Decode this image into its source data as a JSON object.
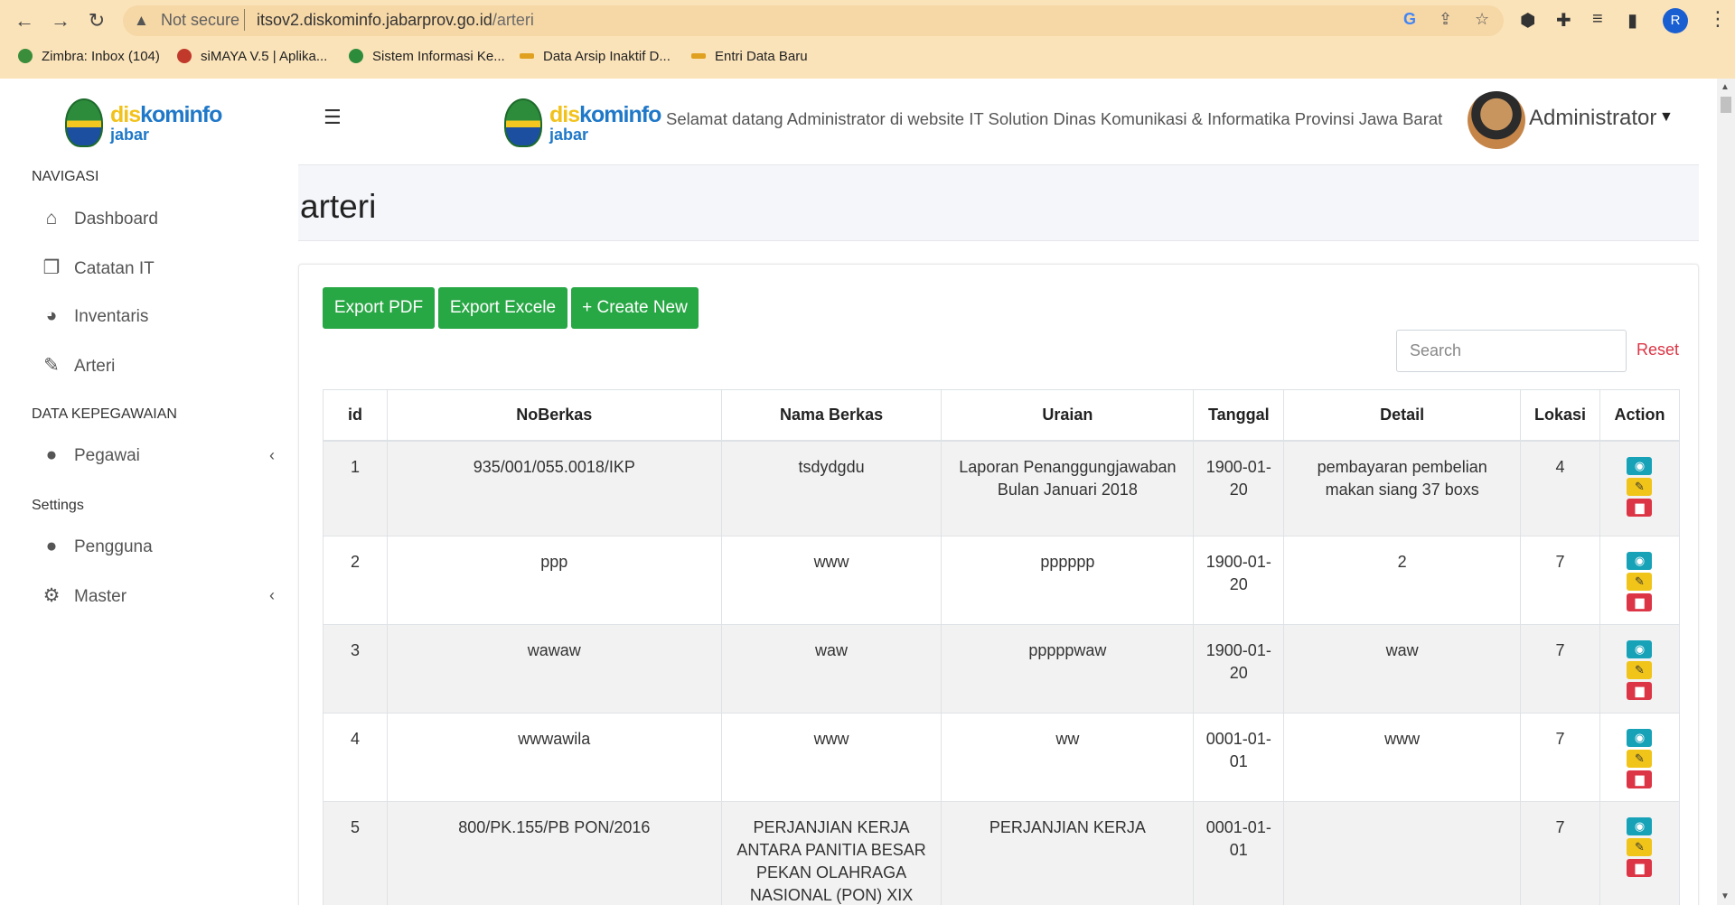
{
  "browser": {
    "security": "Not secure",
    "url_host": "itsov2.diskominfo.jabarprov.go.id",
    "url_path": "/arteri",
    "profile_initial": "R",
    "bookmarks": [
      {
        "label": "Zimbra: Inbox (104)",
        "color": "#3a8d3a"
      },
      {
        "label": "siMAYA V.5 | Aplika...",
        "color": "#c0392b"
      },
      {
        "label": "Sistem Informasi Ke...",
        "color": "#2d8c3c"
      },
      {
        "label": "Data Arsip Inaktif D...",
        "color": "#e0a020"
      },
      {
        "label": "Entri Data Baru",
        "color": "#e0a020"
      }
    ]
  },
  "brand": {
    "part1": "dis",
    "part2": "kominfo",
    "part3": "jabar"
  },
  "sidebar": {
    "sections": [
      "NAVIGASI",
      "DATA KEPEGAWAIAN",
      "Settings"
    ],
    "items": [
      {
        "label": "Dashboard",
        "icon": "home-icon",
        "glyph": "⌂"
      },
      {
        "label": "Catatan IT",
        "icon": "copy-icon",
        "glyph": "❐"
      },
      {
        "label": "Inventaris",
        "icon": "chart-pie-icon",
        "glyph": "◕"
      },
      {
        "label": "Arteri",
        "icon": "edit-icon",
        "glyph": "✎"
      },
      {
        "label": "Pegawai",
        "icon": "user-icon",
        "glyph": "👤"
      },
      {
        "label": "Pengguna",
        "icon": "user-plus-icon",
        "glyph": "👥"
      },
      {
        "label": "Master",
        "icon": "cog-icon",
        "glyph": "⚙"
      }
    ]
  },
  "header": {
    "welcome": "Selamat datang Administrator di website IT Solution Dinas Komunikasi & Informatika Provinsi Jawa Barat",
    "user": "Administrator"
  },
  "main": {
    "title": "arteri",
    "buttons": {
      "export_pdf": "Export PDF",
      "export_excel": "Export Excele",
      "create": "+ Create New"
    },
    "search_placeholder": "Search",
    "reset": "Reset",
    "columns": [
      "id",
      "NoBerkas",
      "Nama Berkas",
      "Uraian",
      "Tanggal",
      "Detail",
      "Lokasi",
      "Action"
    ],
    "rows": [
      [
        "1",
        "935/001/055.0018/IKP",
        "tsdydgdu",
        "Laporan Penanggungjawaban Bulan Januari 2018",
        "1900-01-20",
        "pembayaran pembelian makan siang 37 boxs",
        "4"
      ],
      [
        "2",
        "ppp",
        "www",
        "pppppp",
        "1900-01-20",
        "2",
        "7"
      ],
      [
        "3",
        "wawaw",
        "waw",
        "pppppwaw",
        "1900-01-20",
        "waw",
        "7"
      ],
      [
        "4",
        "wwwawila",
        "www",
        "ww",
        "0001-01-01",
        "www",
        "7"
      ],
      [
        "5",
        "800/PK.155/PB PON/2016",
        "PERJANJIAN KERJA ANTARA PANITIA BESAR PEKAN OLAHRAGA NASIONAL (PON) XIX DAN",
        "PERJANJIAN KERJA",
        "0001-01-01",
        "",
        "7"
      ]
    ]
  }
}
